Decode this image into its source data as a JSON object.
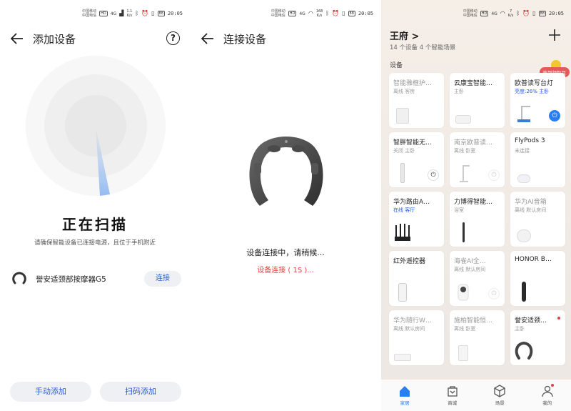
{
  "status": {
    "carrier1": "中国移动",
    "carrier2": "中国电信",
    "net": "4G",
    "battery": "88",
    "time": "20:05",
    "speeds": [
      {
        "value": "1.1",
        "unit": "K/s"
      },
      {
        "value": "168",
        "unit": "K/s"
      },
      {
        "value": "7",
        "unit": "K/s"
      }
    ]
  },
  "scan": {
    "title": "添加设备",
    "heading": "正在扫描",
    "tip": "请确保智能设备已连接电源，且位于手机附近",
    "device_name": "誉安适颈部按摩器G5",
    "connect_label": "连接",
    "manual_add": "手动添加",
    "scan_add": "扫码添加",
    "help": "?"
  },
  "connect": {
    "title": "连接设备",
    "message": "设备连接中，请稍候...",
    "progress": "设备连接 ( 1S )..."
  },
  "home": {
    "name": "王府",
    "chevron": ">",
    "summary": "14 个设备  4 个智能场景",
    "promo": "签到领智豆",
    "section": "设备",
    "add_symbol": "+",
    "devices": [
      {
        "name": "智能雅框护…",
        "status": "离线 客房",
        "off": true,
        "icon": "device-box"
      },
      {
        "name": "云康宝智能…",
        "status": "主卧",
        "off": false,
        "icon": "scale"
      },
      {
        "name": "欧普读写台灯",
        "status_on": "亮度:26% 主卧",
        "off": false,
        "icon": "desk-lamp",
        "power": "blue"
      },
      {
        "name": "智胖智能无…",
        "status": "关闭 主卧",
        "off": false,
        "icon": "fan",
        "power": "normal"
      },
      {
        "name": "南京欧普读…",
        "status": "离线 卧室",
        "off": true,
        "icon": "lamp",
        "power": "dim"
      },
      {
        "name": "FlyPods 3",
        "status": "未连接",
        "off": false,
        "icon": "earbuds"
      },
      {
        "name": "华为路由A…",
        "status_on": "在线 客厅",
        "off": false,
        "icon": "router"
      },
      {
        "name": "力博得智能…",
        "status": "浴室",
        "off": false,
        "icon": "toothbrush"
      },
      {
        "name": "华为AI音箱",
        "status": "离线 默认房间",
        "off": true,
        "icon": "speaker"
      },
      {
        "name": "红外遥控器",
        "status": "",
        "off": false,
        "icon": "remote"
      },
      {
        "name": "海雀AI全…",
        "status": "离线 默认房间",
        "off": true,
        "icon": "camera",
        "power": "dim"
      },
      {
        "name": "HONOR B…",
        "status": "",
        "off": false,
        "icon": "band"
      },
      {
        "name": "华为随行W…",
        "status": "离线 默认房间",
        "off": true,
        "icon": "wifi-box"
      },
      {
        "name": "施柏智能恒…",
        "status": "离线 卧室",
        "off": true,
        "icon": "kettle"
      },
      {
        "name": "誉安适颈…",
        "status": "主卧",
        "off": false,
        "icon": "neck-massager",
        "dot": true
      }
    ],
    "tabs": [
      {
        "label": "家居",
        "icon": "home-icon",
        "active": true
      },
      {
        "label": "商城",
        "icon": "store-icon",
        "active": false
      },
      {
        "label": "场景",
        "icon": "scene-icon",
        "active": false
      },
      {
        "label": "我的",
        "icon": "profile-icon",
        "active": false
      }
    ]
  },
  "colors": {
    "accent": "#2a5bd7",
    "power_on": "#2a7ff0",
    "error": "#e0433b",
    "radar_sweep": "#8fb8f0"
  }
}
